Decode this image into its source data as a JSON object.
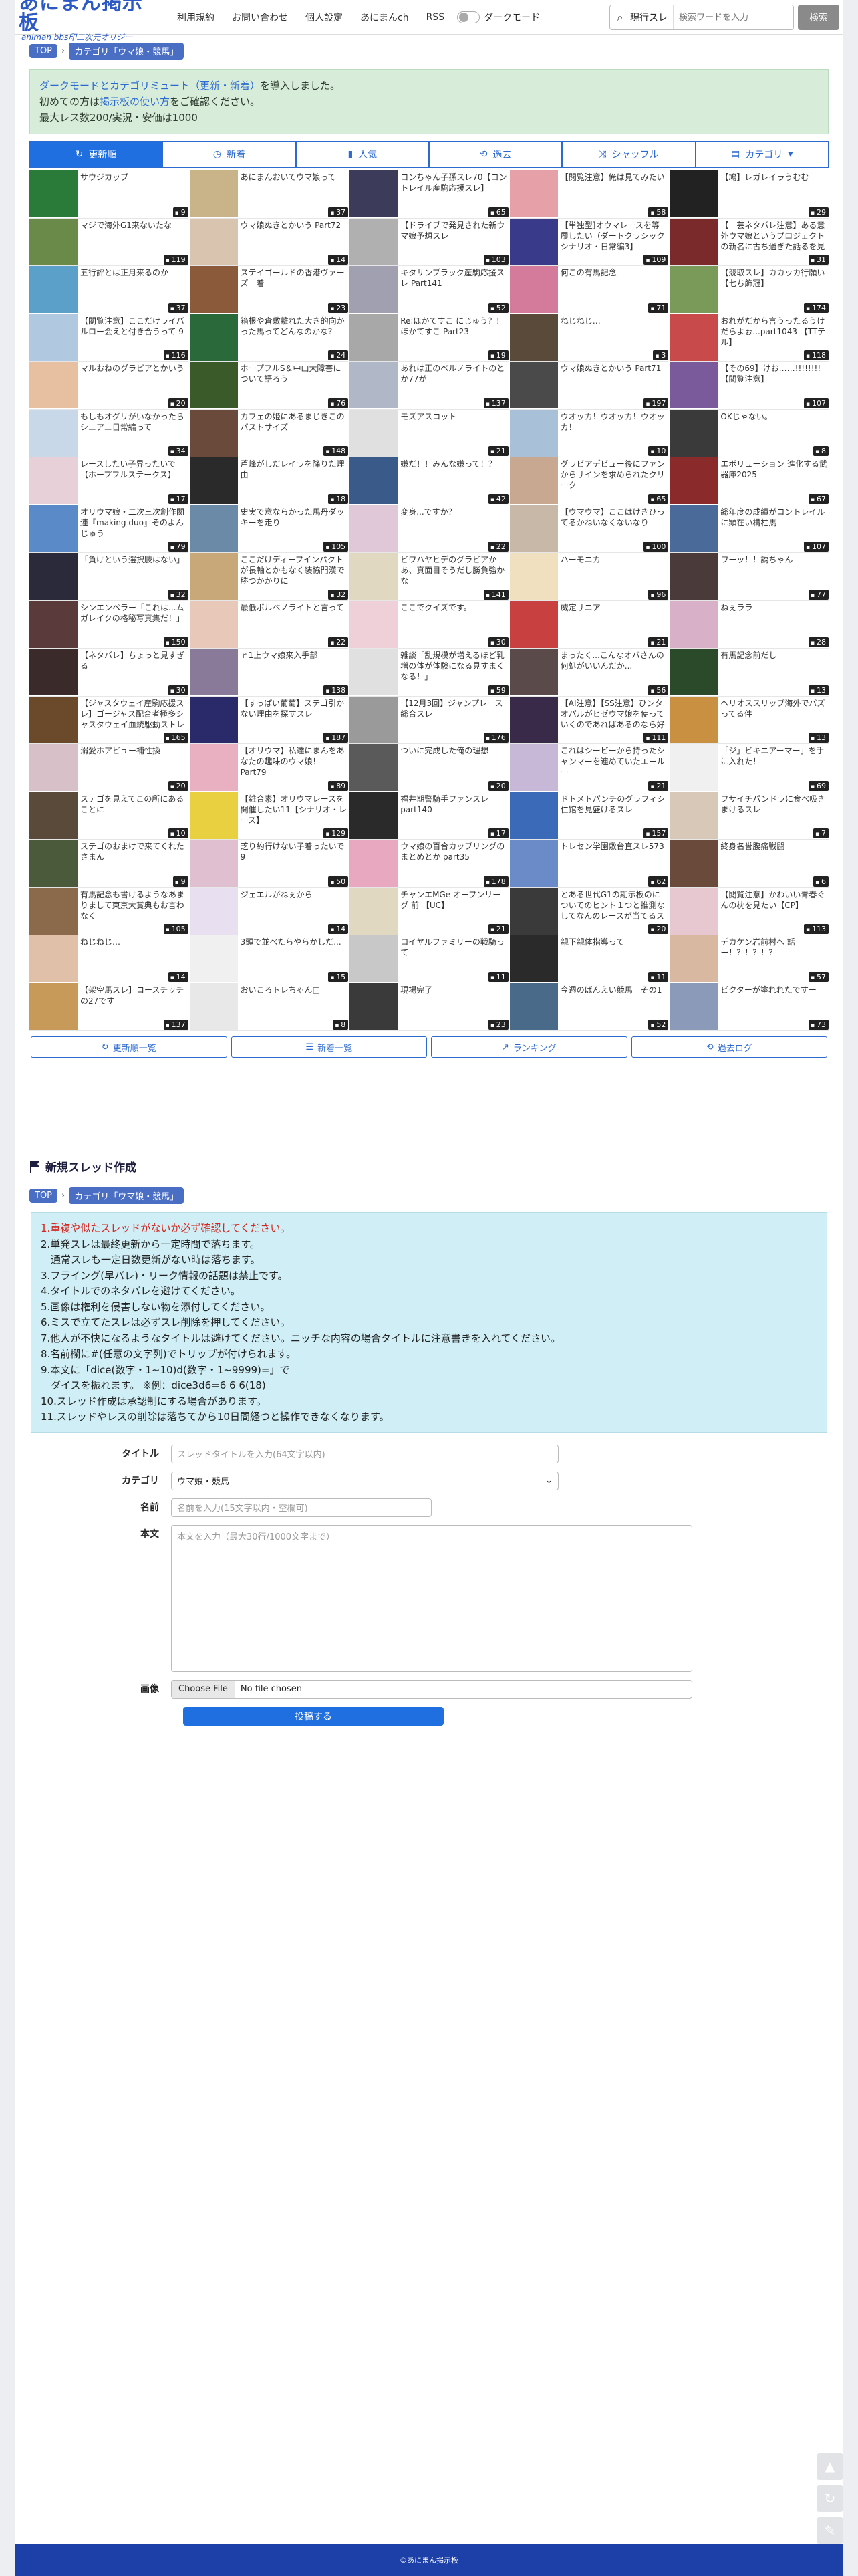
{
  "header": {
    "logo_main": "あにまん掲示板",
    "logo_sub": "animan bbs印二次元オリジー",
    "nav": [
      "利用規約",
      "お問い合わせ",
      "個人設定",
      "あにまんch",
      "RSS"
    ],
    "dark_mode_label": "ダークモード",
    "search_scope": "現行スレ",
    "search_placeholder": "検索ワードを入力",
    "search_button": "検索"
  },
  "breadcrumb": [
    "TOP",
    "カテゴリ「ウマ娘・競馬」"
  ],
  "notice": {
    "line1_link": "ダークモードとカテゴリミュート（更新・新着）",
    "line1_rest": "を導入しました。",
    "line2_pre": "初めての方は",
    "line2_link": "掲示板の使い方",
    "line2_rest": "をご確認ください。",
    "line3": "最大レス数200/実況・安価は1000"
  },
  "tabs": [
    {
      "label": "更新順",
      "icon": "refresh-icon",
      "active": true
    },
    {
      "label": "新着",
      "icon": "clock-icon",
      "active": false
    },
    {
      "label": "人気",
      "icon": "bar-chart-icon",
      "active": false
    },
    {
      "label": "過去",
      "icon": "history-icon",
      "active": false
    },
    {
      "label": "シャッフル",
      "icon": "shuffle-icon",
      "active": false
    },
    {
      "label": "カテゴリ",
      "icon": "folder-icon",
      "active": false
    }
  ],
  "threads": [
    {
      "title": "サウジカップ",
      "count": "9",
      "color": "#2a7a3a"
    },
    {
      "title": "あにまんおいてウマ娘って",
      "count": "37",
      "color": "#c9b48a"
    },
    {
      "title": "コンちゃん子孫スレ70【コントレイル産駒応援スレ】",
      "count": "65",
      "color": "#3c3c5a"
    },
    {
      "title": "【閲覧注意】俺は見てみたい",
      "count": "58",
      "color": "#e6a0a8"
    },
    {
      "title": "【鳩】レガレイラうむむ",
      "count": "29",
      "color": "#222"
    },
    {
      "title": "マジで海外G1来ないたな",
      "count": "119",
      "color": "#6a8a4a"
    },
    {
      "title": "ウマ娘ぬきとかいう Part72",
      "count": "14",
      "color": "#d9c4b0"
    },
    {
      "title": "【ドライブで発見された新ウマ娘予想スレ",
      "count": "103",
      "color": "#b0b0b0"
    },
    {
      "title": "【単独型]オウマレースを等履したい（ダートクラシックシナリオ・日常編3】",
      "count": "109",
      "color": "#3a3a8a"
    },
    {
      "title": "【一芸ネタバレ注意】ある意外ウマ娘というプロジェクトの新名に古ち過ぎた話るを見ろる",
      "count": "31",
      "color": "#7a2a2a"
    },
    {
      "title": "五行評とは正月来るのか",
      "count": "37",
      "color": "#5aa0c8"
    },
    {
      "title": "ステイゴールドの香港ヴァーズ一着",
      "count": "23",
      "color": "#8a5a3a"
    },
    {
      "title": "キタサンブラック産駒応援スレ Part141",
      "count": "52",
      "color": "#a0a0b0"
    },
    {
      "title": "何この有馬記念",
      "count": "71",
      "color": "#d47a9a"
    },
    {
      "title": "【競取スレ】カカッカ行願い【七ち飾冠】",
      "count": "174",
      "color": "#7a9a5a"
    },
    {
      "title": "【閲覧注意】ここだけライバルロー会えと付き合うって 9",
      "count": "116",
      "color": "#b0c8e0"
    },
    {
      "title": "箱根や倉敷離れた大き的向かった馬ってどんなのかな？",
      "count": "24",
      "color": "#2a6a3a"
    },
    {
      "title": "Re:ほかてすこ にじゅう？！ほかてすこ Part23",
      "count": "19",
      "color": "#a8a8a8"
    },
    {
      "title": "ねじねじ…",
      "count": "3",
      "color": "#5a4a3a"
    },
    {
      "title": "おれがだから言うったるうけだらよぉ...part1043 【TTテル】",
      "count": "118",
      "color": "#c84a4a"
    },
    {
      "title": "マルおねのグラビアとかいう",
      "count": "20",
      "color": "#e6c0a0"
    },
    {
      "title": "ホープフルS＆中山大障害について語ろう",
      "count": "76",
      "color": "#3a5a2a"
    },
    {
      "title": "あれは正のベルノライトのとか77が",
      "count": "137",
      "color": "#b0b8c8"
    },
    {
      "title": "ウマ娘ぬきとかいう Part71",
      "count": "197",
      "color": "#4a4a4a"
    },
    {
      "title": "【その69】けお……!!!!!!!!【閲覧注意】",
      "count": "107",
      "color": "#7a5a9a"
    },
    {
      "title": "もしもオグリがいなかったらシニアニ日常編って",
      "count": "34",
      "color": "#c8d8e8"
    },
    {
      "title": "カフェの姫にあるまじきこのバストサイズ",
      "count": "148",
      "color": "#6a4a3a"
    },
    {
      "title": "モズアスコット",
      "count": "21",
      "color": "#e0e0e0"
    },
    {
      "title": "ウオッカ！ウオッカ！ウオッカ！",
      "count": "10",
      "color": "#a8c0d8"
    },
    {
      "title": "OKじゃない。",
      "count": "8",
      "color": "#3a3a3a"
    },
    {
      "title": "レースしたい子界ったいで【ホープフルステークス】",
      "count": "17",
      "color": "#e8d0d8"
    },
    {
      "title": "芦峰がしだレイラを降りた理由",
      "count": "18",
      "color": "#2a2a2a"
    },
    {
      "title": "嫌だ！！みんな嫌って！？",
      "count": "42",
      "color": "#3a5a8a"
    },
    {
      "title": "グラビアデビュー後にファンからサインを求められたクリーク",
      "count": "65",
      "color": "#c8a890"
    },
    {
      "title": "エボリューション 進化する武器庫2025",
      "count": "67",
      "color": "#8a2a2a"
    },
    {
      "title": "オリウマ娘・二次三次創作関連『making duo』そのよんじゅう",
      "count": "79",
      "color": "#5a8ac8"
    },
    {
      "title": "史実で意ならかった馬丹ダッキーを走り",
      "count": "105",
      "color": "#6a8aa8"
    },
    {
      "title": "変身...ですか？",
      "count": "22",
      "color": "#e0c8d8"
    },
    {
      "title": "【ウマウマ】ここはけきひってるかねいなくないなり",
      "count": "100",
      "color": "#c8b8a8"
    },
    {
      "title": "総年度の成績がコントレイルに顕在い構柱馬",
      "count": "107",
      "color": "#4a6a9a"
    },
    {
      "title": "「負けという選択肢はない」",
      "count": "32",
      "color": "#2a2a3a"
    },
    {
      "title": "ここだけディープインパクトが長軸とかもなく装協門漢で勝つかかりに",
      "count": "32",
      "color": "#c8a878"
    },
    {
      "title": "ビワハヤヒデのグラビアかあ、真面目そうだし勝負強かな",
      "count": "141",
      "color": "#e0d8c0"
    },
    {
      "title": "ハーモニカ",
      "count": "96",
      "color": "#f0e0c0"
    },
    {
      "title": "ワーッ！！誘ちゃん",
      "count": "77",
      "color": "#4a3a3a"
    },
    {
      "title": "シンエンペラー「これは...ムガレイクの格秘写真集だ！」",
      "count": "150",
      "color": "#5a3a3a"
    },
    {
      "title": "最低ポルベノライトと言って",
      "count": "22",
      "color": "#e8c8b8"
    },
    {
      "title": "ここでクイズです。",
      "count": "30",
      "color": "#f0d0d8"
    },
    {
      "title": "威定サニア",
      "count": "21",
      "color": "#c84040"
    },
    {
      "title": "ねぇララ",
      "count": "28",
      "color": "#d8b0c8"
    },
    {
      "title": "【ネタバレ】ちょっと見すぎる",
      "count": "30",
      "color": "#3a2a2a"
    },
    {
      "title": "ｒ1上ウマ娘来入手部",
      "count": "138",
      "color": "#8a7a9a"
    },
    {
      "title": "雑談「乱規模が増えるほど乳増の体が体験になる見すまくなる！」",
      "count": "59",
      "color": "#e0e0e0"
    },
    {
      "title": "まったく...こんなオバさんの何処がいいんだか...",
      "count": "56",
      "color": "#5a4a4a"
    },
    {
      "title": "有馬記念前だし",
      "count": "13",
      "color": "#2a4a2a"
    },
    {
      "title": "【ジャスタウェイ産駒応援スレ】ゴージャス配合者極多シャスタウェイ血統駆動ストレク",
      "count": "165",
      "color": "#6a4a2a"
    },
    {
      "title": "【すっぱい葡萄】ステゴ引かない理由を探すスレ",
      "count": "187",
      "color": "#2a2a6a"
    },
    {
      "title": "【12月3回】ジャンプレース総合スレ",
      "count": "176",
      "color": "#9a9a9a"
    },
    {
      "title": "【AI注意】【SS注意】ひンタオパルがヒゼウマ娘を使っていくのであればあるのなら好きにしてくれよ",
      "count": "111",
      "color": "#3a2a4a"
    },
    {
      "title": "ヘリオススリップ海外でバズってる件",
      "count": "13",
      "color": "#c89040"
    },
    {
      "title": "溺愛ホアビュー補性換",
      "count": "20",
      "color": "#d8c0c8"
    },
    {
      "title": "【オリウマ】私達にまんをあなたの趣味のウマ娘！ Part79",
      "count": "89",
      "color": "#e8b0c0"
    },
    {
      "title": "ついに完成した俺の理想",
      "count": "20",
      "color": "#5a5a5a"
    },
    {
      "title": "これはシービーから持ったシャンマーを連めていたエールー",
      "count": "21",
      "color": "#c8b8d8"
    },
    {
      "title": "「ジ」ビキニアーマー」を手に入れた！",
      "count": "69",
      "color": "#f0f0f0"
    },
    {
      "title": "ステゴを見えてこの所にあることに",
      "count": "10",
      "color": "#5a4a3a"
    },
    {
      "title": "【雑合素】オリウマレースを開催したい11【シナリオ・レース】",
      "count": "129",
      "color": "#e8d040"
    },
    {
      "title": "福井期警騎手ファンスレpart140",
      "count": "17",
      "color": "#2a2a2a"
    },
    {
      "title": "ドトメトパンチのグラフィシ仁馆を見盛けるスレ",
      "count": "157",
      "color": "#3a6ab8"
    },
    {
      "title": "フサイチパンドラに食べ吸きまけるスレ",
      "count": "7",
      "color": "#d8c8b8"
    },
    {
      "title": "ステゴのおまけで来てくれたさまん",
      "count": "9",
      "color": "#4a5a3a"
    },
    {
      "title": "芝り約行けない子着ったいで 9",
      "count": "50",
      "color": "#e0c0d0"
    },
    {
      "title": "ウマ娘の百合カップリングのまとめとか part35",
      "count": "178",
      "color": "#e8a8c0"
    },
    {
      "title": "トレセン学園敷台直スレ573",
      "count": "62",
      "color": "#6a8ac8"
    },
    {
      "title": "終身名誉腹痛戦闘",
      "count": "6",
      "color": "#6a4a3a"
    },
    {
      "title": "有馬記念も書けるようなあまりまして東京大賞典もお言わなく",
      "count": "105",
      "color": "#8a6a4a"
    },
    {
      "title": "ジェエルがねぇから",
      "count": "14",
      "color": "#e8e0f0"
    },
    {
      "title": "チャンエMGe オープンリーグ 前 【UC】",
      "count": "21",
      "color": "#e0d8c0"
    },
    {
      "title": "とある世代G1の期示板のについてのヒント１つと推測なしてなんのレースが当てるスレ",
      "count": "20",
      "color": "#3a3a3a"
    },
    {
      "title": "【閲覧注意】かわいい青春ぐんの枕を見たい【CP】",
      "count": "113",
      "color": "#e8c8d0"
    },
    {
      "title": "ねじねじ…",
      "count": "14",
      "color": "#e0c0a8"
    },
    {
      "title": "3頭で並べたらやらかしだ...",
      "count": "15",
      "color": "#f0f0f0"
    },
    {
      "title": "ロイヤルファミリーの戦騎って",
      "count": "11",
      "color": "#c8c8c8"
    },
    {
      "title": "親下親体指導って",
      "count": "11",
      "color": "#2a2a2a"
    },
    {
      "title": "デカケン岩前村へ\n話ー！？！？！？",
      "count": "57",
      "color": "#d8b8a0"
    },
    {
      "title": "【架空馬スレ】コースチッチの27です",
      "count": "137",
      "color": "#c89a5a"
    },
    {
      "title": "おいころトレちゃん□",
      "count": "8",
      "color": "#e8e8e8"
    },
    {
      "title": "現場完了",
      "count": "23",
      "color": "#3a3a3a"
    },
    {
      "title": "今週のばんえい競馬　その1",
      "count": "52",
      "color": "#4a6a8a"
    },
    {
      "title": "ビクターが塗れれたですー",
      "count": "73",
      "color": "#8a9ab8"
    }
  ],
  "bottom_links": [
    {
      "label": "更新順一覧",
      "icon": "refresh-icon"
    },
    {
      "label": "新着一覧",
      "icon": "list-icon"
    },
    {
      "label": "ランキング",
      "icon": "trend-icon"
    },
    {
      "label": "過去ログ",
      "icon": "history-icon"
    }
  ],
  "new_thread": {
    "title": "新規スレッド作成",
    "rules": [
      "1.重複や似たスレッドがないか必ず確認してください。",
      "2.単発スレは最終更新から一定時間で落ちます。",
      "　通常スレも一定日数更新がない時は落ちます。",
      "3.フライング(早バレ)・リーク情報の話題は禁止です。",
      "4.タイトルでのネタバレを避けてください。",
      "5.画像は権利を侵害しない物を添付してください。",
      "6.ミスで立てたスレは必ずスレ削除を押してください。",
      "7.他人が不快になるようなタイトルは避けてください。ニッチな内容の場合タイトルに注意書きを入れてください。",
      "8.名前欄に#(任意の文字列)でトリップが付けられます。",
      "9.本文に「dice(数字・1~10)d(数字・1~9999)=」で",
      "　ダイスを振れます。 ※例：dice3d6=6 6 6(18)",
      "10.スレッド作成は承認制にする場合があります。",
      "11.スレッドやレスの削除は落ちてから10日間経つと操作できなくなります。"
    ],
    "label_title": "タイトル",
    "placeholder_title": "スレッドタイトルを入力(64文字以内)",
    "label_category": "カテゴリ",
    "category_value": "ウマ娘・競馬",
    "label_name": "名前",
    "placeholder_name": "名前を入力(15文字以内・空欄可)",
    "label_body": "本文",
    "placeholder_body": "本文を入力（最大30行/1000文字まで）",
    "label_image": "画像",
    "file_button": "Choose File",
    "file_status": "No file chosen",
    "submit": "投稿する"
  },
  "footer": "©あにまん掲示板"
}
